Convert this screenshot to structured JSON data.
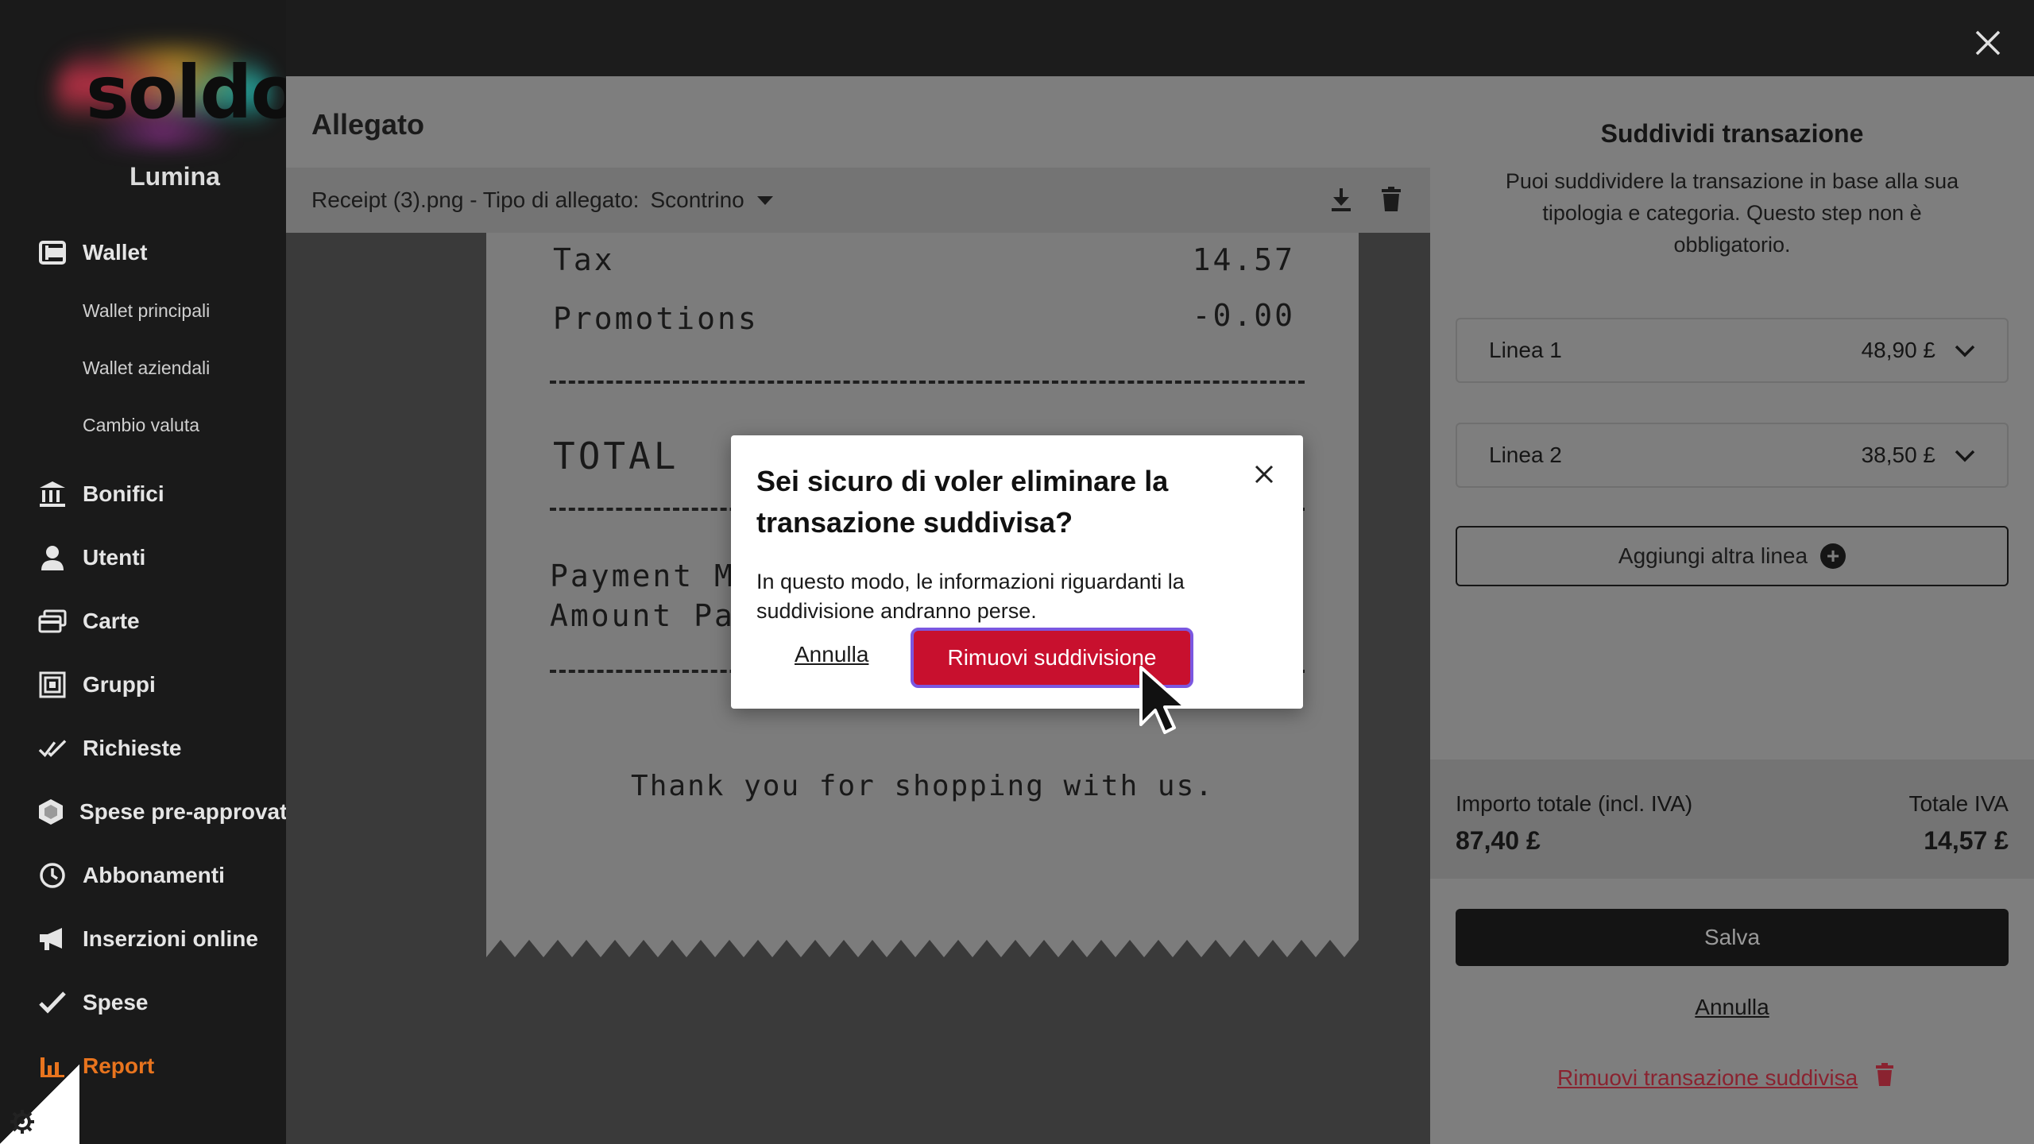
{
  "sidebar": {
    "logo": "soldo",
    "company": "Lumina",
    "items": [
      {
        "label": "Wallet",
        "icon": "wallet-icon"
      },
      {
        "label": "Bonifici",
        "icon": "bank-icon"
      },
      {
        "label": "Utenti",
        "icon": "user-icon"
      },
      {
        "label": "Carte",
        "icon": "cards-icon"
      },
      {
        "label": "Gruppi",
        "icon": "groups-icon"
      },
      {
        "label": "Richieste",
        "icon": "double-check-icon"
      },
      {
        "label": "Spese pre-approvat",
        "icon": "hexagon-icon"
      },
      {
        "label": "Abbonamenti",
        "icon": "clock-icon"
      },
      {
        "label": "Inserzioni online",
        "icon": "megaphone-icon"
      },
      {
        "label": "Spese",
        "icon": "check-icon"
      },
      {
        "label": "Report",
        "icon": "bar-chart-icon"
      }
    ],
    "wallet_sub": [
      "Wallet principali",
      "Wallet aziendali",
      "Cambio valuta"
    ],
    "active_color": "#e8741e"
  },
  "attachment": {
    "title": "Allegato",
    "file_name": "Receipt (3).png - Tipo di allegato:",
    "type_value": "Scontrino",
    "receipt": {
      "tax_label": "Tax",
      "tax_value": "14.57",
      "promo_label": "Promotions",
      "promo_value": "-0.00",
      "total_label": "TOTAL",
      "payment_label": "Payment Me",
      "amount_label": "Amount Pai",
      "thanks": "Thank you for shopping with us."
    }
  },
  "split": {
    "title": "Suddividi transazione",
    "description": "Puoi suddividere la transazione in base alla sua tipologia e categoria. Questo step non è obbligatorio.",
    "lines": [
      {
        "label": "Linea 1",
        "amount": "48,90 £"
      },
      {
        "label": "Linea 2",
        "amount": "38,50 £"
      }
    ],
    "add_line": "Aggiungi altra linea",
    "total_label": "Importo totale (incl. IVA)",
    "total_value": "87,40 £",
    "vat_label": "Totale IVA",
    "vat_value": "14,57 £",
    "save": "Salva",
    "cancel": "Annulla",
    "remove": "Rimuovi transazione suddivisa"
  },
  "modal": {
    "title": "Sei sicuro di voler eliminare la transazione suddivisa?",
    "body": "In questo modo, le informazioni riguardanti la suddivisione andranno perse.",
    "cancel": "Annulla",
    "confirm": "Rimuovi suddivisione",
    "confirm_color": "#c8102e"
  }
}
